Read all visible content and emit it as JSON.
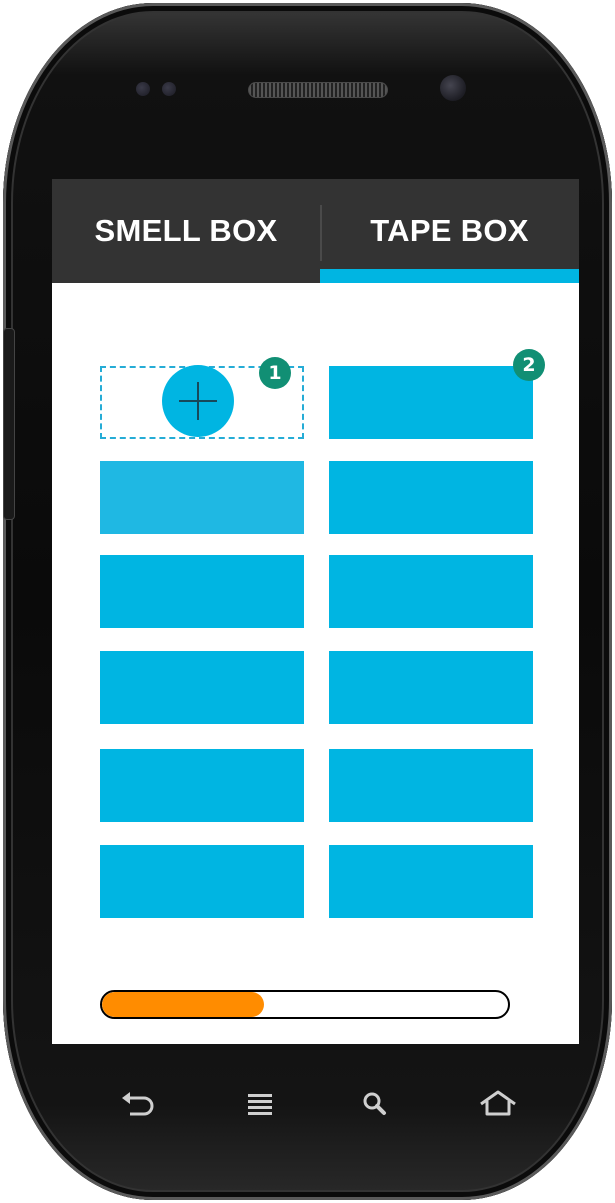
{
  "tabs": [
    {
      "label": "SMELL BOX",
      "active": false
    },
    {
      "label": "TAPE BOX",
      "active": true
    }
  ],
  "badges": [
    "1",
    "2"
  ],
  "add_button": {
    "icon": "plus-icon"
  },
  "progress": {
    "value_percent": 40
  },
  "nav": {
    "icons": [
      "back-icon",
      "menu-icon",
      "search-icon",
      "home-icon"
    ]
  },
  "colors": {
    "accent": "#00b5e2",
    "tabbar": "#333333",
    "badge": "#118f74",
    "progress_fill": "#ff8c00"
  }
}
